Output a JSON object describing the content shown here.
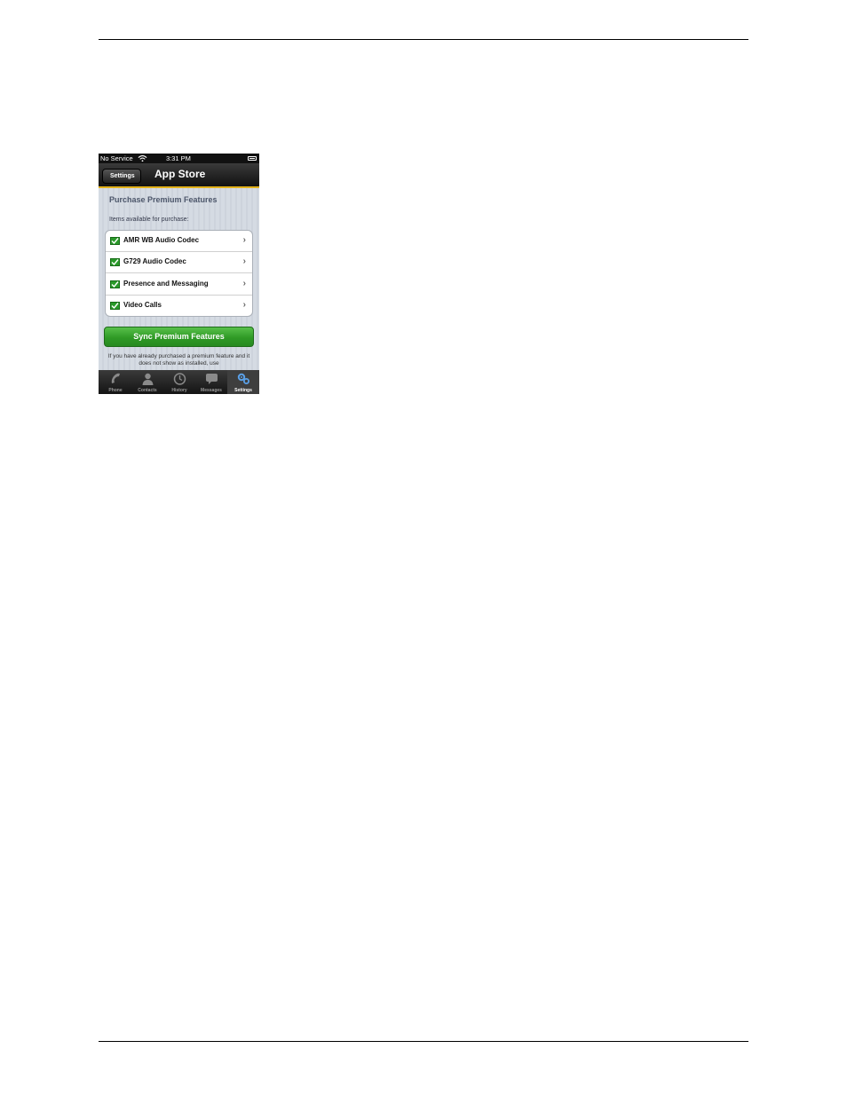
{
  "status_bar": {
    "carrier": "No Service",
    "time": "3:31 PM"
  },
  "nav": {
    "back_label": "Settings",
    "title": "App Store"
  },
  "section": {
    "title": "Purchase Premium Features",
    "subtitle": "Items available for purchase:"
  },
  "items": [
    {
      "label": "AMR WB Audio Codec",
      "checked": true
    },
    {
      "label": "G729 Audio Codec",
      "checked": true
    },
    {
      "label": "Presence and Messaging",
      "checked": true
    },
    {
      "label": "Video Calls",
      "checked": true
    }
  ],
  "sync_button": "Sync Premium Features",
  "note": "If you have already purchased a premium feature and it does not show as installed, use",
  "tabs": [
    {
      "label": "Phone",
      "icon": "phone-icon",
      "selected": false
    },
    {
      "label": "Contacts",
      "icon": "contacts-icon",
      "selected": false
    },
    {
      "label": "History",
      "icon": "history-clock-icon",
      "selected": false
    },
    {
      "label": "Messages",
      "icon": "messages-bubble-icon",
      "selected": false
    },
    {
      "label": "Settings",
      "icon": "gears-icon",
      "selected": true
    }
  ],
  "colors": {
    "accent_line": "#e3b21b",
    "sync_green": "#2f9a26",
    "check_green": "#2a9a2a"
  }
}
